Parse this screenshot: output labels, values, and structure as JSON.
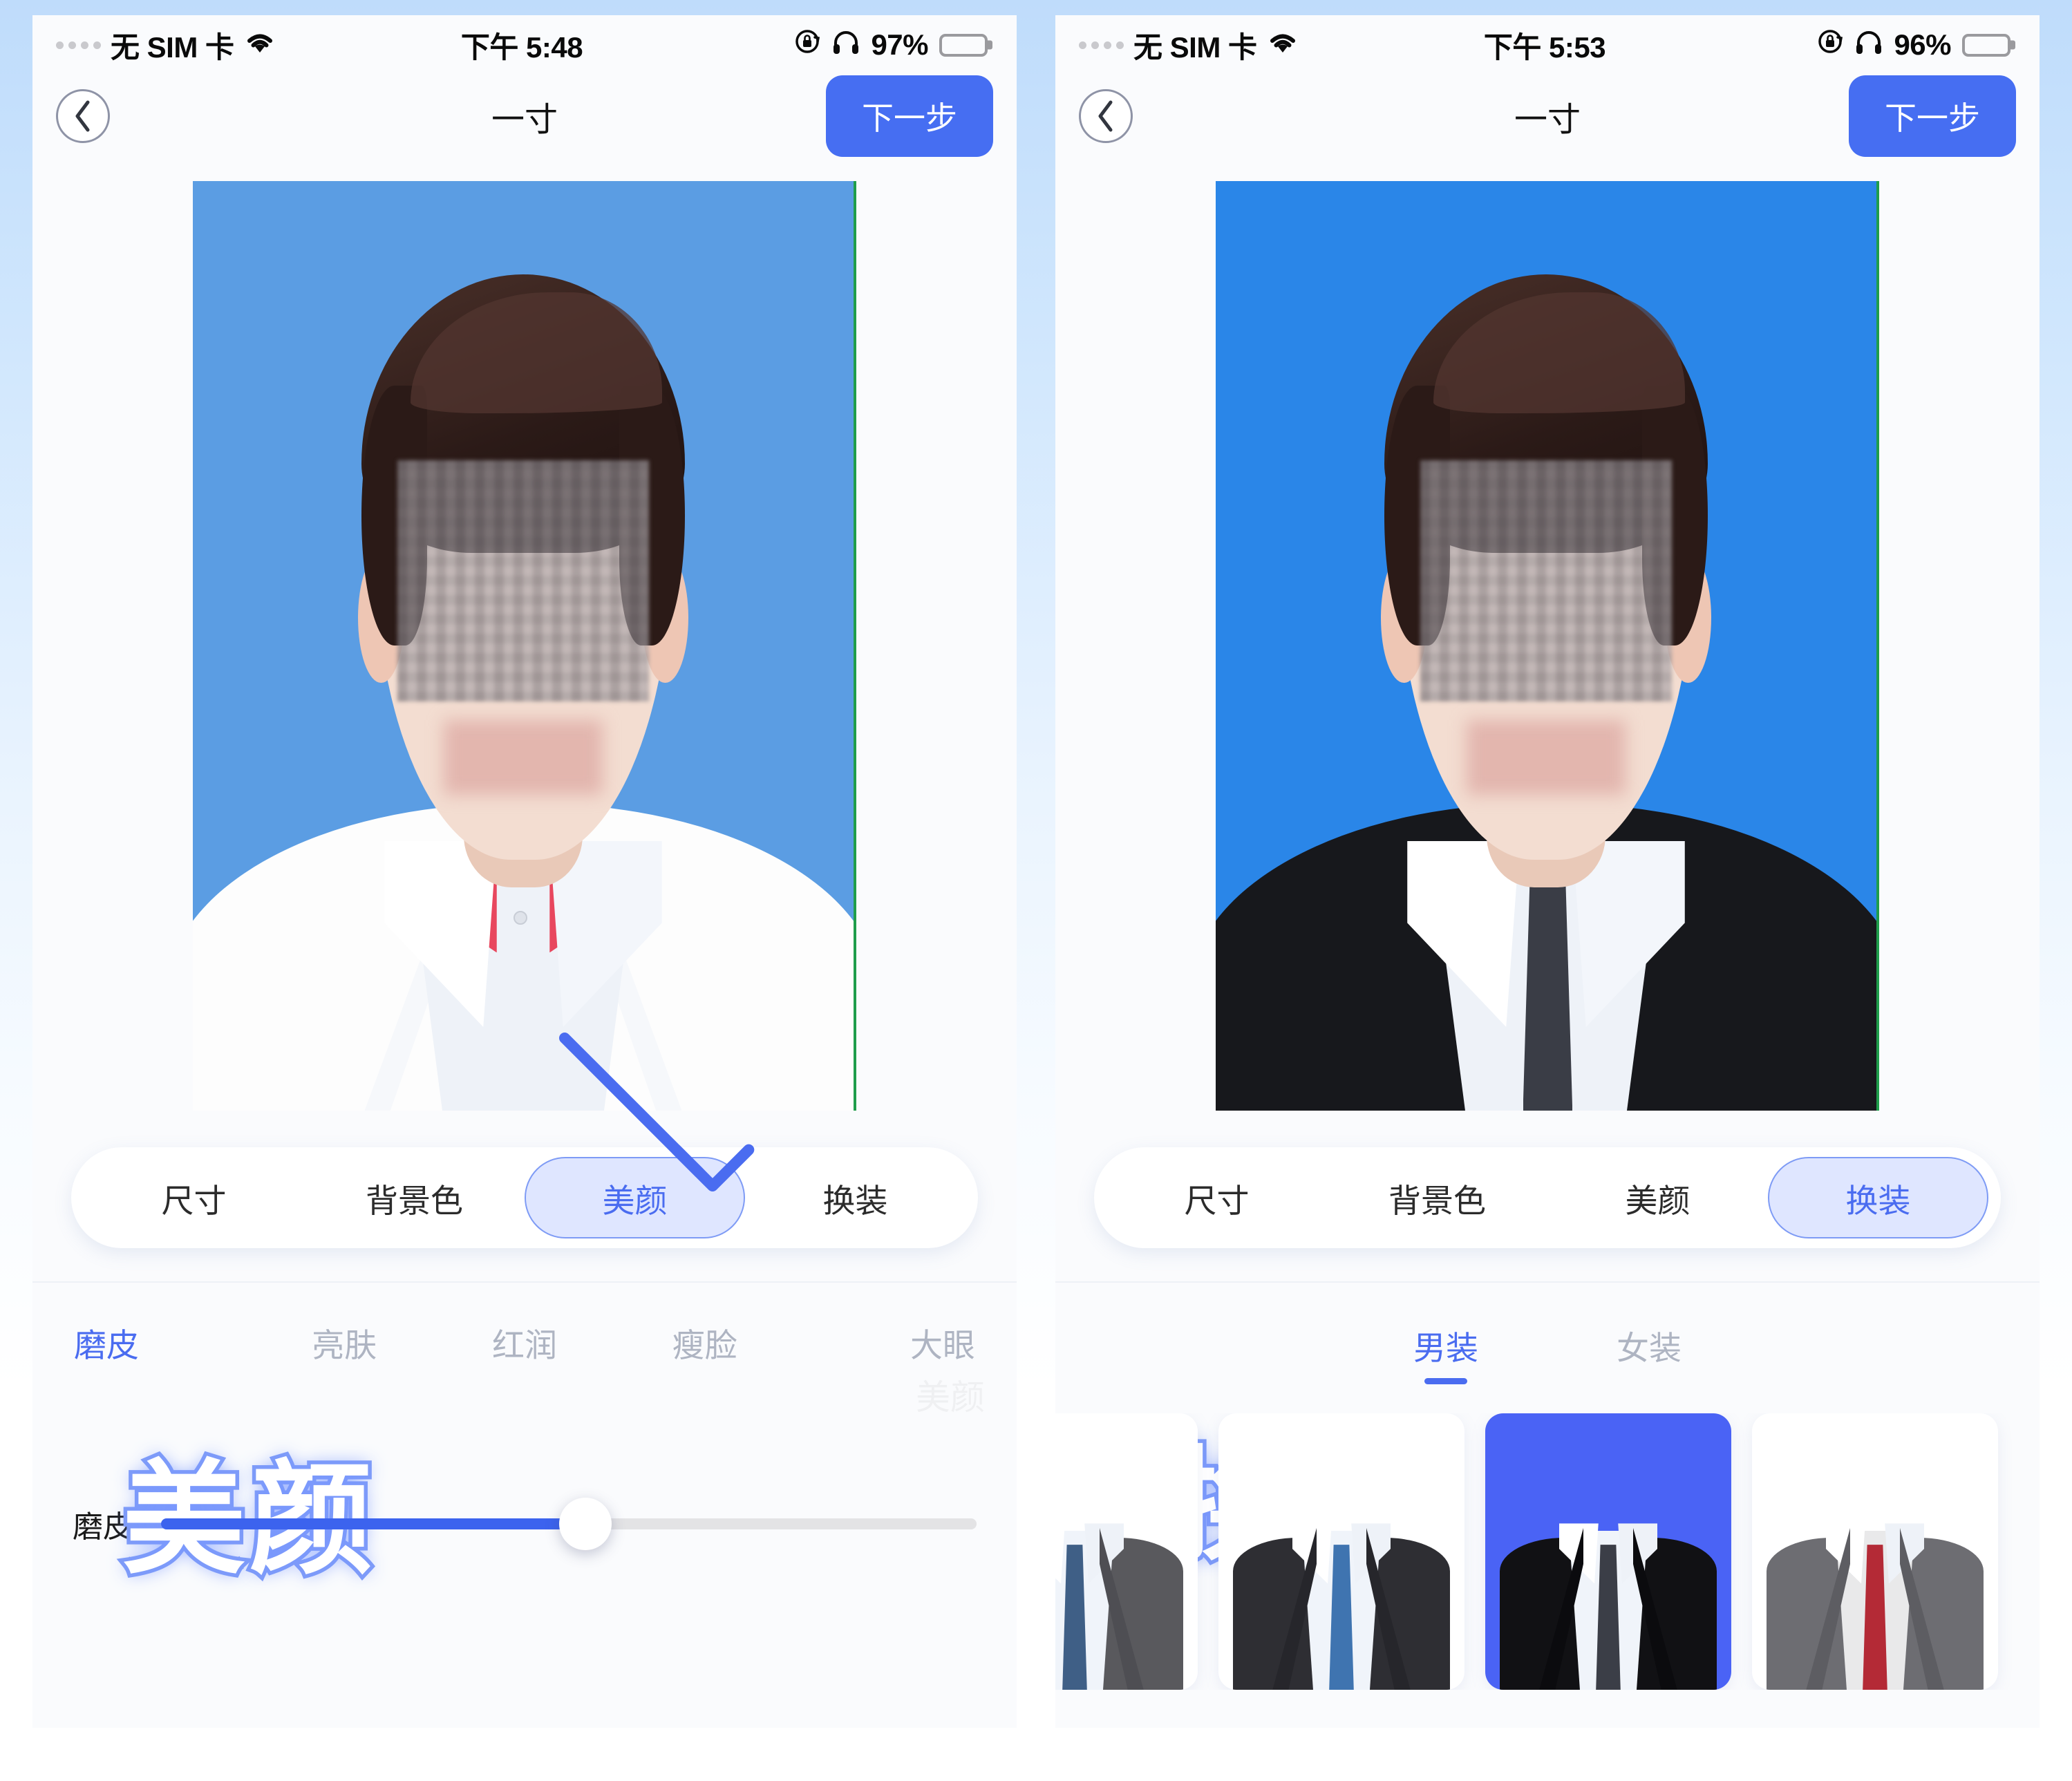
{
  "accent": "#466ef2",
  "accent_light": "#dfe6ff",
  "muted": "#aeb4c2",
  "screens": [
    {
      "id": "beauty",
      "statusbar": {
        "carrier": "无 SIM 卡",
        "wifi_icon": "wifi-icon",
        "time": "下午 5:48",
        "rotation_lock_icon": "rotation-lock-icon",
        "headphones_icon": "headphones-icon",
        "battery_percent": "97%",
        "battery_level": 97
      },
      "nav": {
        "back_icon": "chevron-left-icon",
        "title": "一寸",
        "next_label": "下一步"
      },
      "photo": {
        "background_color": "#5b9de3",
        "outfit": "white-shirt-bowtie",
        "overlay_caption": "美颜",
        "arrow_icon": "arrow-down-right-icon"
      },
      "tabs": [
        {
          "label": "尺寸",
          "active": false
        },
        {
          "label": "背景色",
          "active": false
        },
        {
          "label": "美颜",
          "active": true
        },
        {
          "label": "换装",
          "active": false
        }
      ],
      "beauty": {
        "subtabs": [
          {
            "label": "磨皮",
            "active": true
          },
          {
            "label": "亮肤",
            "active": false
          },
          {
            "label": "红润",
            "active": false
          },
          {
            "label": "瘦脸",
            "active": false
          },
          {
            "label": "大眼",
            "active": false
          }
        ],
        "slider": {
          "label": "磨皮",
          "value": 52
        }
      },
      "watermark": "美颜"
    },
    {
      "id": "outfit",
      "statusbar": {
        "carrier": "无 SIM 卡",
        "wifi_icon": "wifi-icon",
        "time": "下午 5:53",
        "rotation_lock_icon": "rotation-lock-icon",
        "headphones_icon": "headphones-icon",
        "battery_percent": "96%",
        "battery_level": 96
      },
      "nav": {
        "back_icon": "chevron-left-icon",
        "title": "一寸",
        "next_label": "下一步"
      },
      "photo": {
        "background_color": "#2a86e8",
        "outfit": "black-suit-dark-tie",
        "overlay_caption": "换装",
        "arrow_icon": "arrow-down-right-icon"
      },
      "tabs": [
        {
          "label": "尺寸",
          "active": false
        },
        {
          "label": "背景色",
          "active": false
        },
        {
          "label": "美颜",
          "active": false
        },
        {
          "label": "换装",
          "active": true
        }
      ],
      "outfit_panel": {
        "gender_tabs": [
          {
            "label": "男装",
            "active": true
          },
          {
            "label": "女装",
            "active": false
          }
        ],
        "items": [
          {
            "name": "gray-suit-striped-tie",
            "suit": "#59595d",
            "tie": "#3f5f86",
            "selected": false
          },
          {
            "name": "charcoal-suit-blue-tie",
            "suit": "#2e2e33",
            "tie": "#3f74b0",
            "selected": false
          },
          {
            "name": "black-suit-dark-tie",
            "suit": "#111114",
            "tie": "#3b3e47",
            "selected": true
          },
          {
            "name": "gray-suit-red-tie",
            "suit": "#6d6d72",
            "tie": "#b42a36",
            "selected": false
          }
        ]
      }
    }
  ]
}
